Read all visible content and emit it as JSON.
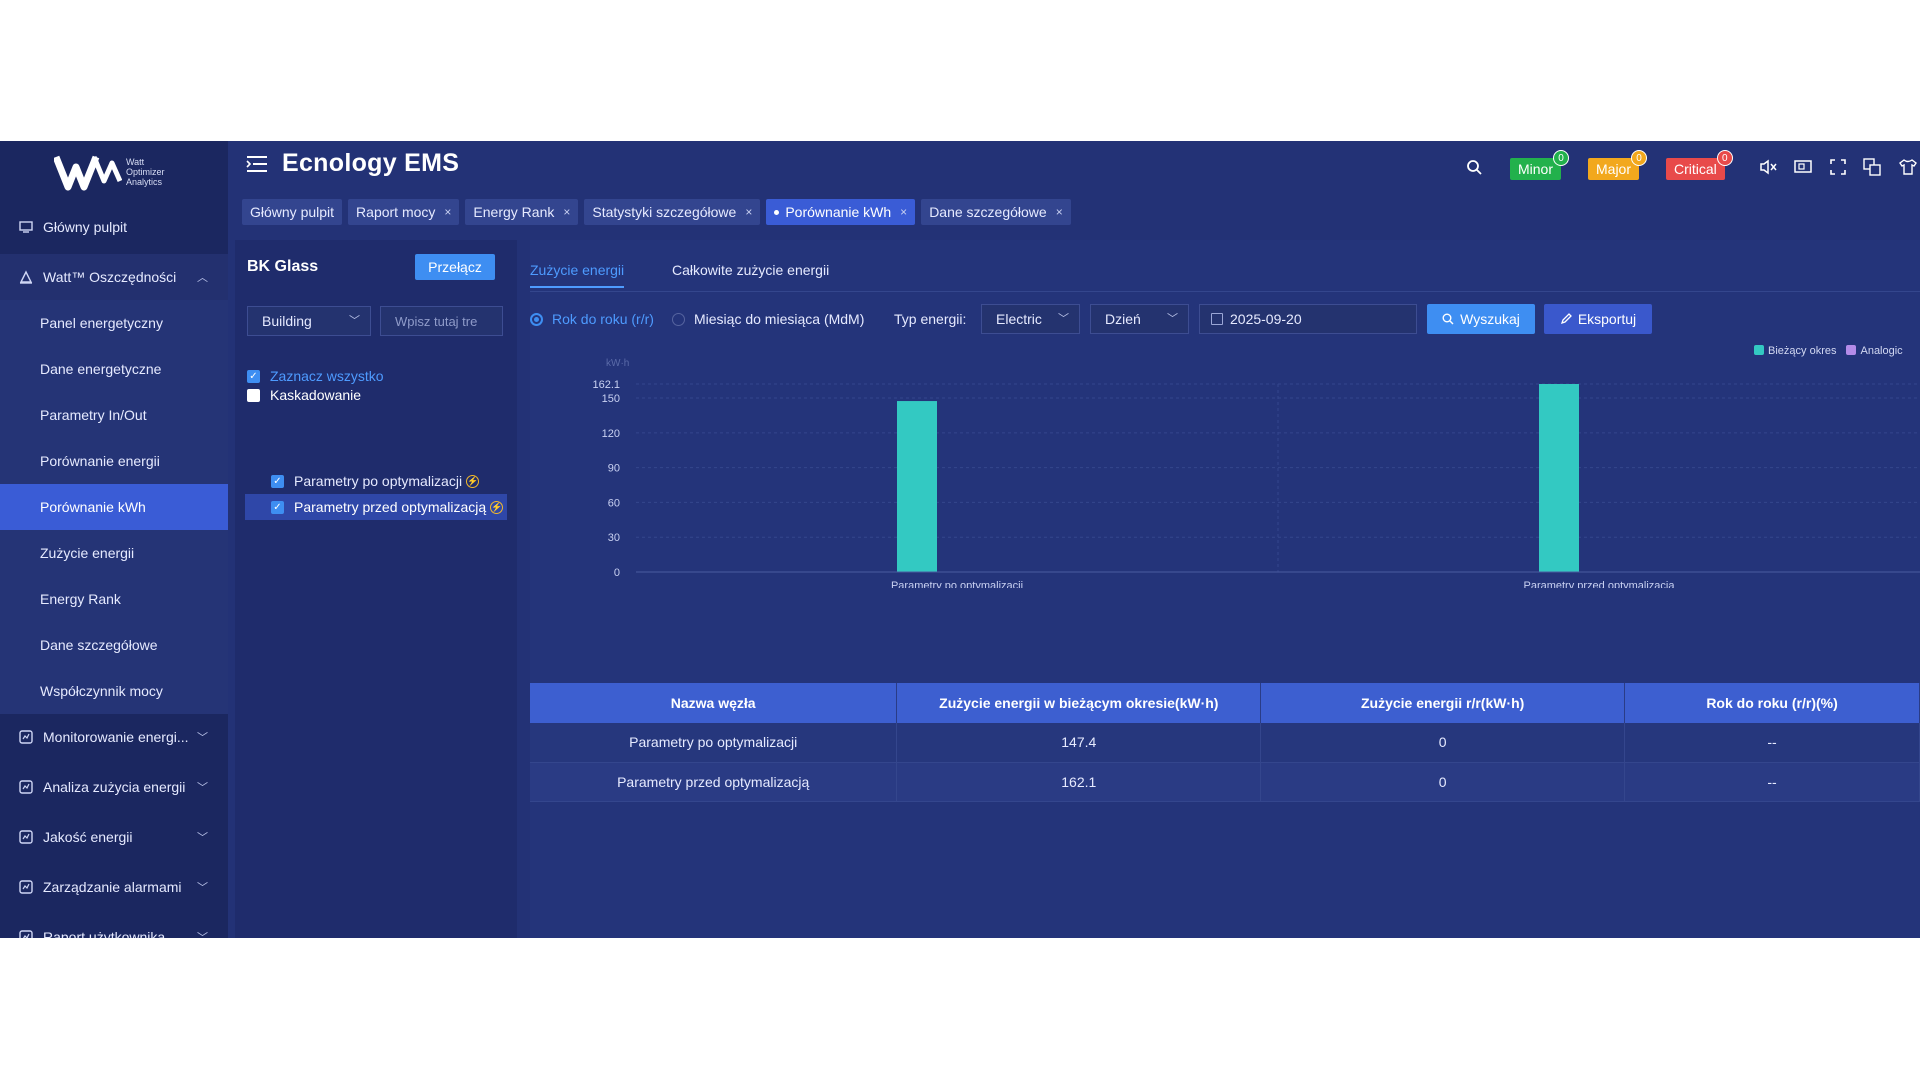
{
  "app": {
    "title": "Ecnology EMS"
  },
  "logo": {
    "line1": "Watt",
    "line2": "Optimizer",
    "line3": "Analytics"
  },
  "sidebar": {
    "dashboard": "Główny pulpit",
    "savings_group": "Watt™ Oszczędności",
    "sub_items": [
      "Panel energetyczny",
      "Dane energetyczne",
      "Parametry In/Out",
      "Porównanie energii",
      "Porównanie kWh",
      "Zużycie energii",
      "Energy Rank",
      "Dane szczegółowe",
      "Współczynnik mocy"
    ],
    "active_sub_item": "Porównanie kWh",
    "groups": [
      "Monitorowanie energi...",
      "Analiza zużycia energii",
      "Jakość energii",
      "Zarządzanie alarmami",
      "Raport użytkownika"
    ]
  },
  "alarms": [
    {
      "label": "Minor",
      "count": "0",
      "color": "#22b14c"
    },
    {
      "label": "Major",
      "count": "0",
      "color": "#f2a81d"
    },
    {
      "label": "Critical",
      "count": "0",
      "color": "#e84a4a"
    }
  ],
  "tabs": [
    {
      "label": "Główny pulpit",
      "closable": false
    },
    {
      "label": "Raport mocy",
      "closable": true
    },
    {
      "label": "Energy Rank",
      "closable": true
    },
    {
      "label": "Statystyki szczegółowe",
      "closable": true
    },
    {
      "label": "Porównanie kWh",
      "closable": true,
      "active": true
    },
    {
      "label": "Dane szczegółowe",
      "closable": true
    }
  ],
  "left_panel": {
    "org_name": "BK Glass",
    "switch_label": "Przełącz",
    "level_select": "Building",
    "search_placeholder": "Wpisz tutaj tre",
    "select_all": "Zaznacz wszystko",
    "cascade": "Kaskadowanie",
    "nodes": [
      "Parametry po optymalizacji",
      "Parametry przed optymalizacją"
    ]
  },
  "main": {
    "sub_tabs": [
      "Zużycie energii",
      "Całkowite zużycie energii"
    ],
    "radio_yoy": "Rok do roku (r/r)",
    "radio_mom": "Miesiąc do miesiąca (MdM)",
    "energy_type_label": "Typ energii:",
    "energy_type_value": "Electric",
    "period_value": "Dzień",
    "date_value": "2025-09-20",
    "search_label": "Wyszukaj",
    "export_label": "Eksportuj"
  },
  "chart_data": {
    "type": "bar",
    "ylabel": "kW·h",
    "categories": [
      "Parametry po optymalizacji",
      "Parametry przed optymalizacją"
    ],
    "series": [
      {
        "name": "Bieżący okres",
        "values": [
          147.4,
          162.1
        ],
        "color": "#33c9c2"
      },
      {
        "name": "Analogic",
        "values": [
          0,
          0
        ],
        "color": "#b48be8"
      }
    ],
    "yticks": [
      0,
      30,
      60,
      90,
      120,
      150
    ],
    "ymax_label": "162.1",
    "ylim": [
      0,
      162.1
    ],
    "grid": true,
    "legend": "top-right"
  },
  "table": {
    "headers": [
      "Nazwa węzła",
      "Zużycie energii w bieżącym okresie(kW·h)",
      "Zużycie energii r/r(kW·h)",
      "Rok do roku (r/r)(%)"
    ],
    "rows": [
      [
        "Parametry po optymalizacji",
        "147.4",
        "0",
        "--"
      ],
      [
        "Parametry przed optymalizacją",
        "162.1",
        "0",
        "--"
      ]
    ]
  }
}
